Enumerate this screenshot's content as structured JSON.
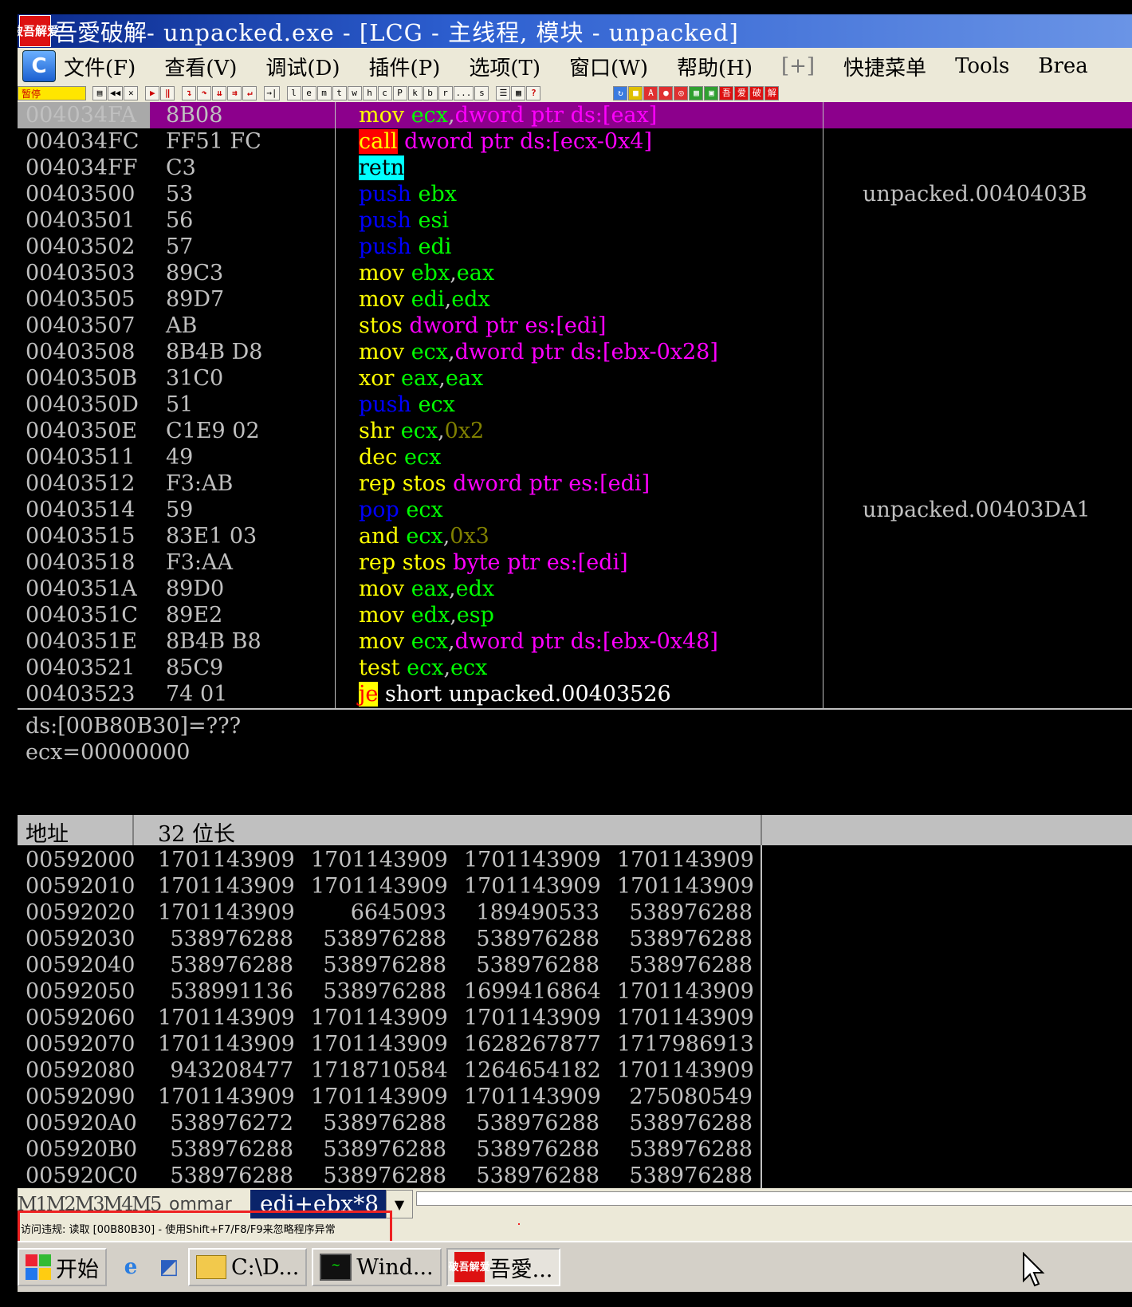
{
  "title": {
    "logo_text": "破吾解爱",
    "app": "吾愛破解",
    "text": " - unpacked.exe - [LCG -  主线程, 模块 - unpacked]"
  },
  "menu": {
    "c_button": "C",
    "items": [
      "文件(F)",
      "查看(V)",
      "调试(D)",
      "插件(P)",
      "选项(T)",
      "窗口(W)",
      "帮助(H)",
      "[+]",
      "快捷菜单",
      "Tools",
      "Brea"
    ]
  },
  "toolbar": {
    "status": "暂停",
    "letters": [
      "l",
      "e",
      "m",
      "t",
      "w",
      "h",
      "c",
      "P",
      "k",
      "b",
      "r",
      "...",
      "s"
    ]
  },
  "cpu": {
    "rows": [
      {
        "addr": "004034FA",
        "hex": "8B08",
        "dis": [
          [
            "mov ",
            "#ffff00"
          ],
          [
            "ecx",
            "#00ff00"
          ],
          [
            ",",
            "#c0c0c0"
          ],
          [
            "dword ptr ds:[eax]",
            "#ff00ff"
          ]
        ],
        "comment": ""
      },
      {
        "addr": "004034FC",
        "hex": "FF51 FC",
        "dis": [
          [
            "call",
            "#ffff00",
            "#ff0000"
          ],
          [
            " ",
            "#c0c0c0"
          ],
          [
            "dword ptr ds:[ecx-0x4]",
            "#ff00ff"
          ]
        ],
        "comment": ""
      },
      {
        "addr": "004034FF",
        "hex": "C3",
        "dis": [
          [
            "retn",
            "#000000",
            "#00ffff"
          ]
        ],
        "comment": ""
      },
      {
        "addr": "00403500",
        "hex": "53",
        "dis": [
          [
            "push ",
            "#0000ff"
          ],
          [
            "ebx",
            "#00ff00"
          ]
        ],
        "comment": "unpacked.0040403B"
      },
      {
        "addr": "00403501",
        "hex": "56",
        "dis": [
          [
            "push ",
            "#0000ff"
          ],
          [
            "esi",
            "#00ff00"
          ]
        ],
        "comment": ""
      },
      {
        "addr": "00403502",
        "hex": "57",
        "dis": [
          [
            "push ",
            "#0000ff"
          ],
          [
            "edi",
            "#00ff00"
          ]
        ],
        "comment": ""
      },
      {
        "addr": "00403503",
        "hex": "89C3",
        "dis": [
          [
            "mov ",
            "#ffff00"
          ],
          [
            "ebx",
            "#00ff00"
          ],
          [
            ",",
            "#c0c0c0"
          ],
          [
            "eax",
            "#00ff00"
          ]
        ],
        "comment": ""
      },
      {
        "addr": "00403505",
        "hex": "89D7",
        "dis": [
          [
            "mov ",
            "#ffff00"
          ],
          [
            "edi",
            "#00ff00"
          ],
          [
            ",",
            "#c0c0c0"
          ],
          [
            "edx",
            "#00ff00"
          ]
        ],
        "comment": ""
      },
      {
        "addr": "00403507",
        "hex": "AB",
        "dis": [
          [
            "stos ",
            "#ffff00"
          ],
          [
            "dword ptr es:[edi]",
            "#ff00ff"
          ]
        ],
        "comment": ""
      },
      {
        "addr": "00403508",
        "hex": "8B4B D8",
        "dis": [
          [
            "mov ",
            "#ffff00"
          ],
          [
            "ecx",
            "#00ff00"
          ],
          [
            ",",
            "#c0c0c0"
          ],
          [
            "dword ptr ds:[ebx-0x28]",
            "#ff00ff"
          ]
        ],
        "comment": ""
      },
      {
        "addr": "0040350B",
        "hex": "31C0",
        "dis": [
          [
            "xor ",
            "#ffff00"
          ],
          [
            "eax",
            "#00ff00"
          ],
          [
            ",",
            "#c0c0c0"
          ],
          [
            "eax",
            "#00ff00"
          ]
        ],
        "comment": ""
      },
      {
        "addr": "0040350D",
        "hex": "51",
        "dis": [
          [
            "push ",
            "#0000ff"
          ],
          [
            "ecx",
            "#00ff00"
          ]
        ],
        "comment": ""
      },
      {
        "addr": "0040350E",
        "hex": "C1E9 02",
        "dis": [
          [
            "shr ",
            "#ffff00"
          ],
          [
            "ecx",
            "#00ff00"
          ],
          [
            ",",
            "#c0c0c0"
          ],
          [
            "0x2",
            "#808000"
          ]
        ],
        "comment": ""
      },
      {
        "addr": "00403511",
        "hex": "49",
        "dis": [
          [
            "dec ",
            "#ffff00"
          ],
          [
            "ecx",
            "#00ff00"
          ]
        ],
        "comment": ""
      },
      {
        "addr": "00403512",
        "hex": "F3:AB",
        "dis": [
          [
            "rep stos ",
            "#ffff00"
          ],
          [
            "dword ptr es:[edi]",
            "#ff00ff"
          ]
        ],
        "comment": ""
      },
      {
        "addr": "00403514",
        "hex": "59",
        "dis": [
          [
            "pop ",
            "#0000ff"
          ],
          [
            "ecx",
            "#00ff00"
          ]
        ],
        "comment": "unpacked.00403DA1"
      },
      {
        "addr": "00403515",
        "hex": "83E1 03",
        "dis": [
          [
            "and ",
            "#ffff00"
          ],
          [
            "ecx",
            "#00ff00"
          ],
          [
            ",",
            "#c0c0c0"
          ],
          [
            "0x3",
            "#808000"
          ]
        ],
        "comment": ""
      },
      {
        "addr": "00403518",
        "hex": "F3:AA",
        "dis": [
          [
            "rep stos ",
            "#ffff00"
          ],
          [
            "byte ptr es:[edi]",
            "#ff00ff"
          ]
        ],
        "comment": ""
      },
      {
        "addr": "0040351A",
        "hex": "89D0",
        "dis": [
          [
            "mov ",
            "#ffff00"
          ],
          [
            "eax",
            "#00ff00"
          ],
          [
            ",",
            "#c0c0c0"
          ],
          [
            "edx",
            "#00ff00"
          ]
        ],
        "comment": ""
      },
      {
        "addr": "0040351C",
        "hex": "89E2",
        "dis": [
          [
            "mov ",
            "#ffff00"
          ],
          [
            "edx",
            "#00ff00"
          ],
          [
            ",",
            "#c0c0c0"
          ],
          [
            "esp",
            "#00ff00"
          ]
        ],
        "comment": ""
      },
      {
        "addr": "0040351E",
        "hex": "8B4B B8",
        "dis": [
          [
            "mov ",
            "#ffff00"
          ],
          [
            "ecx",
            "#00ff00"
          ],
          [
            ",",
            "#c0c0c0"
          ],
          [
            "dword ptr ds:[ebx-0x48]",
            "#ff00ff"
          ]
        ],
        "comment": ""
      },
      {
        "addr": "00403521",
        "hex": "85C9",
        "dis": [
          [
            "test ",
            "#ffff00"
          ],
          [
            "ecx",
            "#00ff00"
          ],
          [
            ",",
            "#c0c0c0"
          ],
          [
            "ecx",
            "#00ff00"
          ]
        ],
        "comment": ""
      },
      {
        "addr": "00403523",
        "hex": "74 01",
        "dis": [
          [
            "je",
            "#ff0000",
            "#ffff00"
          ],
          [
            " short unpacked.00403526",
            "#ffffff"
          ]
        ],
        "comment": ""
      }
    ]
  },
  "info": {
    "line1": "ds:[00B80B30]=???",
    "line2": "ecx=00000000"
  },
  "dump": {
    "header_addr": "地址",
    "header_fmt": "32 位长",
    "rows": [
      {
        "addr": "00592000",
        "vals": [
          "1701143909",
          "1701143909",
          "1701143909",
          "1701143909"
        ]
      },
      {
        "addr": "00592010",
        "vals": [
          "1701143909",
          "1701143909",
          "1701143909",
          "1701143909"
        ]
      },
      {
        "addr": "00592020",
        "vals": [
          "1701143909",
          "6645093",
          "189490533",
          "538976288"
        ]
      },
      {
        "addr": "00592030",
        "vals": [
          "538976288",
          "538976288",
          "538976288",
          "538976288"
        ]
      },
      {
        "addr": "00592040",
        "vals": [
          "538976288",
          "538976288",
          "538976288",
          "538976288"
        ]
      },
      {
        "addr": "00592050",
        "vals": [
          "538991136",
          "538976288",
          "1699416864",
          "1701143909"
        ]
      },
      {
        "addr": "00592060",
        "vals": [
          "1701143909",
          "1701143909",
          "1701143909",
          "1701143909"
        ]
      },
      {
        "addr": "00592070",
        "vals": [
          "1701143909",
          "1701143909",
          "1628267877",
          "1717986913"
        ]
      },
      {
        "addr": "00592080",
        "vals": [
          "943208477",
          "1718710584",
          "1264654182",
          "1701143909"
        ]
      },
      {
        "addr": "00592090",
        "vals": [
          "1701143909",
          "1701143909",
          "1701143909",
          "275080549"
        ]
      },
      {
        "addr": "005920A0",
        "vals": [
          "538976272",
          "538976288",
          "538976288",
          "538976288"
        ]
      },
      {
        "addr": "005920B0",
        "vals": [
          "538976288",
          "538976288",
          "538976288",
          "538976288"
        ]
      },
      {
        "addr": "005920C0",
        "vals": [
          "538976288",
          "538976288",
          "538976288",
          "538976288"
        ]
      }
    ]
  },
  "cmdbar": {
    "tabs": "M1M2M3M4M5",
    "command_label": "ommar",
    "combo_value": "edi+ebx*8"
  },
  "status": {
    "text": "访问违规: 读取 [00B80B30] - 使用Shift+F7/F8/F9来忽略程序异常"
  },
  "taskbar": {
    "start": "开始",
    "items": [
      "C:\\D...",
      "Wind...",
      "吾愛..."
    ]
  }
}
